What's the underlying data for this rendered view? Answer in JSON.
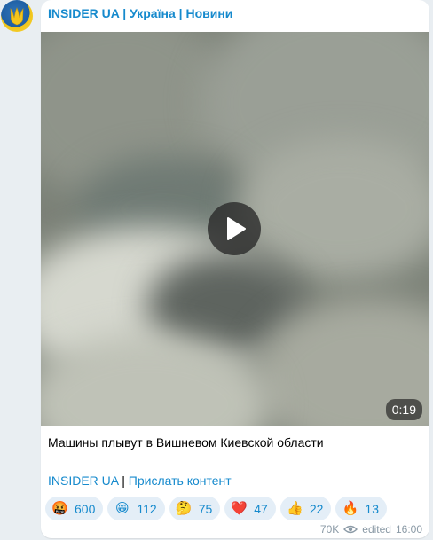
{
  "channel": {
    "name": "INSIDER UA | Україна | Новини",
    "avatar_icon": "ukraine-trident-icon"
  },
  "video": {
    "duration": "0:19",
    "play_icon": "play-icon"
  },
  "caption": "Машины плывут в Вишневом Киевской области",
  "links": {
    "link1": "INSIDER UA",
    "separator": " | ",
    "link2": "Прислать контент"
  },
  "reactions": [
    {
      "emoji": "🤬",
      "count": "600"
    },
    {
      "emoji": "😁",
      "count": "112"
    },
    {
      "emoji": "🤔",
      "count": "75"
    },
    {
      "emoji": "❤️",
      "count": "47"
    },
    {
      "emoji": "👍",
      "count": "22"
    },
    {
      "emoji": "🔥",
      "count": "13"
    }
  ],
  "meta": {
    "views": "70K",
    "views_icon": "eye-icon",
    "edited": "edited",
    "time": "16:00"
  },
  "colors": {
    "link": "#168acd",
    "background": "#e9eef2",
    "reaction_bg": "#e4eef7"
  }
}
